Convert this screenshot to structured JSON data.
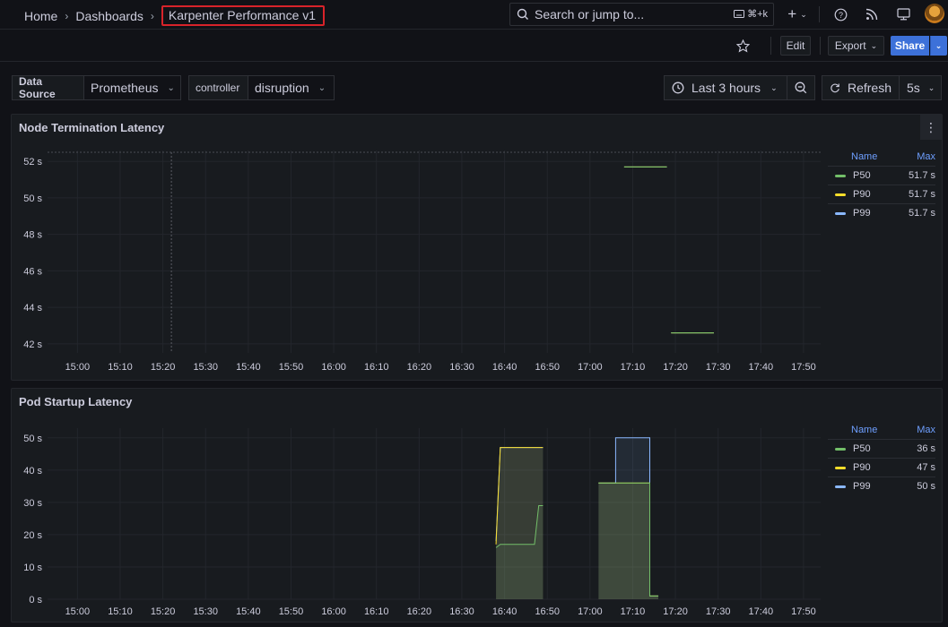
{
  "nav": {
    "home": "Home",
    "dashboards": "Dashboards",
    "current": "Karpenter Performance v1",
    "search_placeholder": "Search or jump to...",
    "search_shortcut": "⌘+k",
    "plus": "+"
  },
  "toolbar": {
    "edit": "Edit",
    "export": "Export",
    "share": "Share"
  },
  "variables": {
    "datasource_label": "Data Source",
    "datasource_value": "Prometheus",
    "controller_label": "controller",
    "controller_value": "disruption"
  },
  "time": {
    "range": "Last 3 hours",
    "refresh": "Refresh",
    "interval": "5s"
  },
  "panels": [
    {
      "title": "Node Termination Latency",
      "legend_name_header": "Name",
      "legend_max_header": "Max",
      "legend": [
        {
          "name": "P50",
          "max": "51.7 s",
          "color": "#73bf69"
        },
        {
          "name": "P90",
          "max": "51.7 s",
          "color": "#fade2a"
        },
        {
          "name": "P99",
          "max": "51.7 s",
          "color": "#8ab8ff"
        }
      ]
    },
    {
      "title": "Pod Startup Latency",
      "legend_name_header": "Name",
      "legend_max_header": "Max",
      "legend": [
        {
          "name": "P50",
          "max": "36 s",
          "color": "#73bf69"
        },
        {
          "name": "P90",
          "max": "47 s",
          "color": "#fade2a"
        },
        {
          "name": "P99",
          "max": "50 s",
          "color": "#8ab8ff"
        }
      ]
    }
  ],
  "chart_data": [
    {
      "type": "line",
      "title": "Node Termination Latency",
      "x_ticks": [
        "15:00",
        "15:10",
        "15:20",
        "15:30",
        "15:40",
        "15:50",
        "16:00",
        "16:10",
        "16:20",
        "16:30",
        "16:40",
        "16:50",
        "17:00",
        "17:10",
        "17:20",
        "17:30",
        "17:40",
        "17:50"
      ],
      "y_ticks": [
        "42 s",
        "44 s",
        "46 s",
        "48 s",
        "50 s",
        "52 s"
      ],
      "ylim": [
        41.5,
        52.6
      ],
      "xlim": [
        "14:53",
        "17:54"
      ],
      "grid": true,
      "legend_position": "right",
      "series": [
        {
          "name": "P50",
          "color": "#73bf69",
          "segments": [
            [
              [
                "17:08",
                51.7
              ],
              [
                "17:18",
                51.7
              ]
            ],
            [
              [
                "17:19",
                42.6
              ],
              [
                "17:29",
                42.6
              ]
            ]
          ]
        },
        {
          "name": "P90",
          "color": "#fade2a",
          "segments": [
            [
              [
                "17:08",
                51.7
              ],
              [
                "17:18",
                51.7
              ]
            ],
            [
              [
                "17:19",
                42.6
              ],
              [
                "17:29",
                42.6
              ]
            ]
          ]
        },
        {
          "name": "P99",
          "color": "#8ab8ff",
          "segments": [
            [
              [
                "17:08",
                51.7
              ],
              [
                "17:18",
                51.7
              ]
            ],
            [
              [
                "17:19",
                42.6
              ],
              [
                "17:29",
                42.6
              ]
            ]
          ]
        }
      ]
    },
    {
      "type": "area",
      "title": "Pod Startup Latency",
      "x_ticks": [
        "15:00",
        "15:10",
        "15:20",
        "15:30",
        "15:40",
        "15:50",
        "16:00",
        "16:10",
        "16:20",
        "16:30",
        "16:40",
        "16:50",
        "17:00",
        "17:10",
        "17:20",
        "17:30",
        "17:40",
        "17:50"
      ],
      "y_ticks": [
        "0 s",
        "10 s",
        "20 s",
        "30 s",
        "40 s",
        "50 s"
      ],
      "ylim": [
        0,
        53
      ],
      "xlim": [
        "14:53",
        "17:54"
      ],
      "grid": true,
      "legend_position": "right",
      "series": [
        {
          "name": "P50",
          "color": "#73bf69",
          "segments": [
            [
              [
                "16:38",
                16
              ],
              [
                "16:39",
                17
              ],
              [
                "16:47",
                17
              ],
              [
                "16:48",
                29
              ],
              [
                "16:49",
                29
              ]
            ],
            [
              [
                "17:02",
                36
              ],
              [
                "17:14",
                36
              ],
              [
                "17:14",
                1
              ],
              [
                "17:16",
                1
              ]
            ]
          ]
        },
        {
          "name": "P90",
          "color": "#fade2a",
          "segments": [
            [
              [
                "16:38",
                17
              ],
              [
                "16:39",
                47
              ],
              [
                "16:49",
                47
              ]
            ],
            [
              [
                "17:02",
                36
              ],
              [
                "17:14",
                36
              ],
              [
                "17:14",
                1
              ],
              [
                "17:16",
                1
              ]
            ]
          ]
        },
        {
          "name": "P99",
          "color": "#8ab8ff",
          "segments": [
            [
              [
                "16:38",
                18
              ],
              [
                "16:39",
                47
              ],
              [
                "16:49",
                47
              ]
            ],
            [
              [
                "17:02",
                36
              ],
              [
                "17:06",
                36
              ],
              [
                "17:06",
                50
              ],
              [
                "17:14",
                50
              ],
              [
                "17:14",
                1
              ],
              [
                "17:16",
                1
              ]
            ]
          ]
        }
      ]
    }
  ]
}
